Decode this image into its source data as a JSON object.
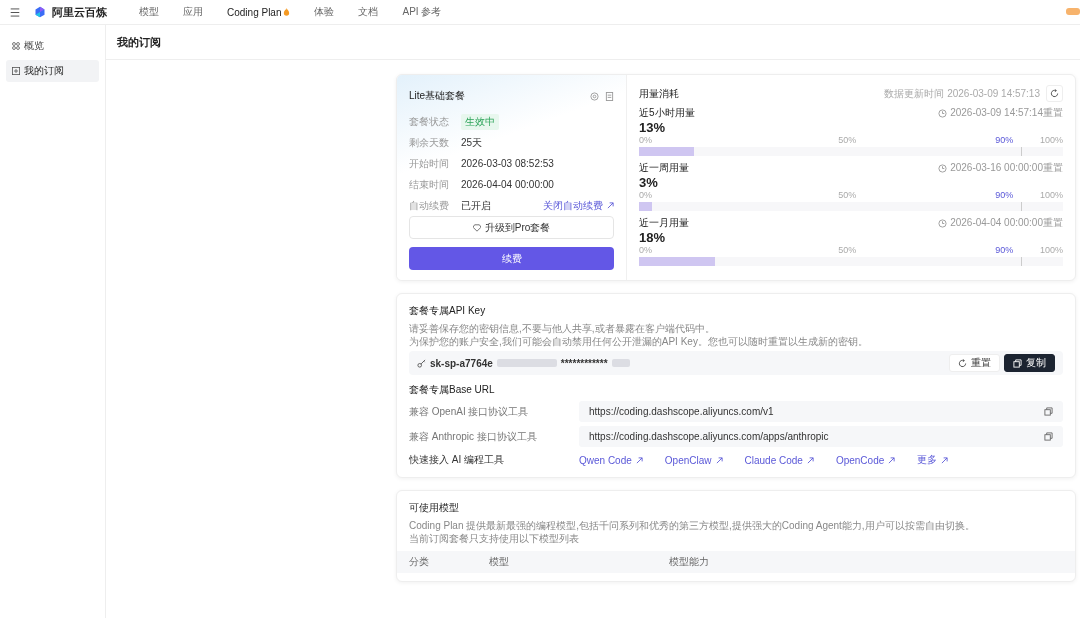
{
  "topbar": {
    "brand": "阿里云百炼",
    "nav": [
      {
        "label": "模型",
        "selected": false,
        "kind": "plain"
      },
      {
        "label": "应用",
        "selected": false,
        "kind": "plain"
      },
      {
        "label": "Coding Plan",
        "selected": true,
        "kind": "hot"
      },
      {
        "label": "体验",
        "selected": false,
        "kind": "plain"
      },
      {
        "label": "文档",
        "selected": false,
        "kind": "plain"
      },
      {
        "label": "API 参考",
        "selected": false,
        "kind": "plain"
      }
    ]
  },
  "sidebar": {
    "items": [
      {
        "label": "概览",
        "selected": false,
        "kind": "overview"
      },
      {
        "label": "我的订阅",
        "selected": true,
        "kind": "subscription"
      }
    ]
  },
  "page_title": "我的订阅",
  "plan": {
    "title": "Lite基础套餐",
    "rows": [
      {
        "label": "套餐状态",
        "value": "生效中",
        "kind": "tag"
      },
      {
        "label": "剩余天数",
        "value": "25天",
        "kind": "text"
      },
      {
        "label": "开始时间",
        "value": "2026-03-03 08:52:53",
        "kind": "text"
      },
      {
        "label": "结束时间",
        "value": "2026-04-04 00:00:00",
        "kind": "text"
      },
      {
        "label": "自动续费",
        "value": "已开启",
        "kind": "text",
        "link": "关闭自动续费"
      }
    ],
    "upgrade_button": "升级到Pro套餐",
    "renew_button": "续费"
  },
  "usage": {
    "title": "用量消耗",
    "updated": "数据更新时间 2026-03-09 14:57:13",
    "items": [
      {
        "label": "近5小时用量",
        "reset": "2026-03-09 14:57:14重置",
        "percent": "13%",
        "level": 0.13,
        "ticks": [
          "0%",
          "50%",
          "90%",
          "100%"
        ]
      },
      {
        "label": "近一周用量",
        "reset": "2026-03-16 00:00:00重置",
        "percent": "3%",
        "level": 0.03,
        "ticks": [
          "0%",
          "50%",
          "90%",
          "100%"
        ]
      },
      {
        "label": "近一月用量",
        "reset": "2026-04-04 00:00:00重置",
        "percent": "18%",
        "level": 0.18,
        "ticks": [
          "0%",
          "50%",
          "90%",
          "100%"
        ]
      }
    ]
  },
  "api_key": {
    "title": "套餐专属API Key",
    "notes": [
      "请妥善保存您的密钥信息,不要与他人共享,或者暴露在客户端代码中。",
      "为保护您的账户安全,我们可能会自动禁用任何公开泄漏的API Key。您也可以随时重置以生成新的密钥。"
    ],
    "key_prefix": "sk-sp-a7764e",
    "key_mask": "************",
    "reset_button": "重置",
    "copy_button": "复制"
  },
  "base_url": {
    "title": "套餐专属Base URL",
    "rows": [
      {
        "label": "兼容 OpenAI 接口协议工具",
        "url": "https://coding.dashscope.aliyuncs.com/v1"
      },
      {
        "label": "兼容 Anthropic 接口协议工具",
        "url": "https://coding.dashscope.aliyuncs.com/apps/anthropic"
      }
    ]
  },
  "quick_access": {
    "label": "快速接入 AI 编程工具",
    "links": [
      "Qwen Code",
      "OpenClaw",
      "Claude Code",
      "OpenCode",
      "更多"
    ]
  },
  "models": {
    "title": "可使用模型",
    "desc": [
      "Coding Plan 提供最新最强的编程模型,包括千问系列和优秀的第三方模型,提供强大的Coding Agent能力,用户可以按需自由切换。",
      "当前订阅套餐只支持使用以下模型列表"
    ],
    "columns": [
      "分类",
      "模型",
      "模型能力"
    ]
  }
}
